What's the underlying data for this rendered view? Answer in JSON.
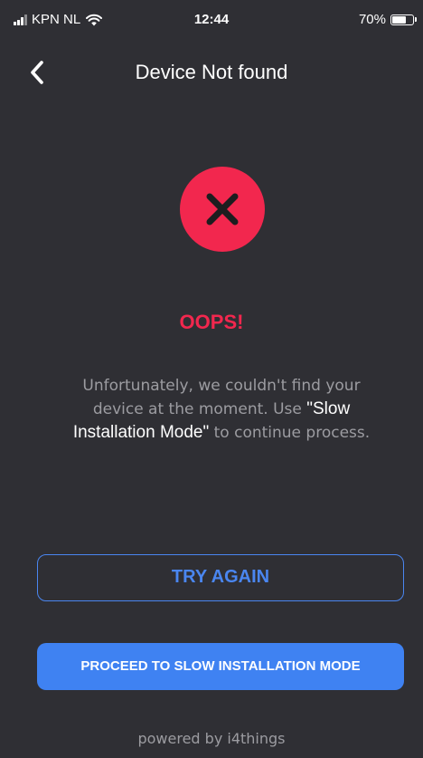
{
  "status_bar": {
    "carrier": "KPN NL",
    "time": "12:44",
    "battery_percent": "70%",
    "battery_level": 0.7,
    "icons": [
      "signal-icon",
      "wifi-icon",
      "battery-icon"
    ]
  },
  "nav": {
    "title": "Device Not found",
    "back_icon": "chevron-left-icon"
  },
  "error": {
    "icon": "close-icon",
    "color": "#f2274e",
    "heading": "OOPS!"
  },
  "message": {
    "part1": "Unfortunately, we couldn't find your device at the moment. Use ",
    "highlight": "\"Slow Installation Mode\"",
    "part2": " to continue process."
  },
  "buttons": {
    "try_again": "TRY AGAIN",
    "proceed": "PROCEED TO SLOW INSTALLATION MODE",
    "accent": "#3f82f2"
  },
  "footer": {
    "text": "powered by i4things"
  }
}
